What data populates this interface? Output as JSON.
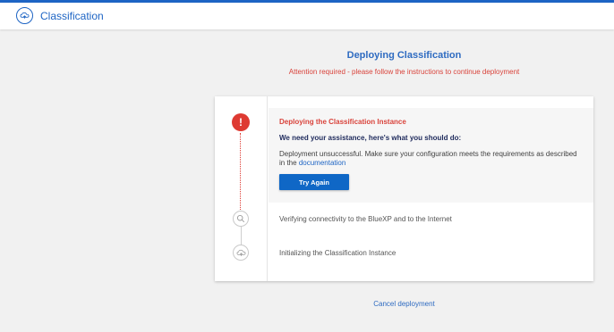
{
  "header": {
    "app_title": "Classification",
    "app_icon": "cloud-home-icon"
  },
  "main": {
    "heading": "Deploying Classification",
    "attention": "Attention required - please follow the instructions to continue deployment"
  },
  "steps": [
    {
      "title": "Deploying the Classification Instance",
      "status": "error",
      "icon": "exclamation-icon",
      "assist_text": "We need your assistance, here's what you should do:",
      "message": "Deployment unsuccessful. Make sure your configuration meets the requirements as described in the",
      "link_label": "documentation",
      "button_label": "Try Again"
    },
    {
      "title": "Verifying connectivity to the BlueXP and to the Internet",
      "status": "pending",
      "icon": "search-icon"
    },
    {
      "title": "Initializing the Classification Instance",
      "status": "pending",
      "icon": "cloud-icon"
    }
  ],
  "footer": {
    "cancel_label": "Cancel deployment"
  },
  "colors": {
    "accent": "#1d64c4",
    "error": "#d9433b",
    "button": "#0f67c6"
  }
}
